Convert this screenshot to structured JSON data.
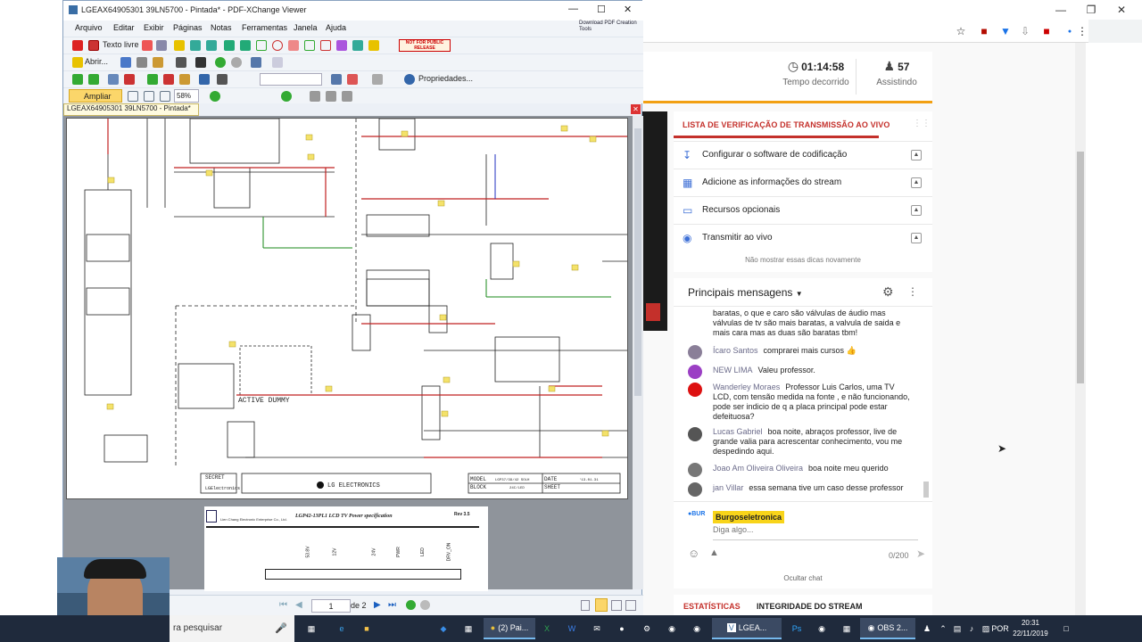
{
  "pdf": {
    "window_title": "LGEAX64905301 39LN5700 - Pintada* - PDF-XChange Viewer",
    "download_pdf_label": "Download PDF Creation Tools",
    "menu": [
      "Arquivo",
      "Editar",
      "Exibir",
      "Páginas",
      "Notas",
      "Ferramentas",
      "Janela",
      "Ajuda"
    ],
    "toolbar": {
      "text_tool": "Texto livre",
      "open": "Abrir...",
      "properties": "Propriedades...",
      "zoom_tool": "Ampliar",
      "zoom_value": "58%",
      "stamp": "NOT FOR PUBLIC RELEASE"
    },
    "doc_tab": "LGEAX64905301 39LN5700 - Pintada*",
    "schematic": {
      "active_dummy": "ACTIVE DUMMY",
      "brand": "LG ELECTRONICS",
      "secret": "SECRET",
      "lg_small": "LGElectronics",
      "model_label": "MODEL",
      "block_label": "BLOCK",
      "date_label": "DATE",
      "sheet_label": "SHEET",
      "model_value": "LGP37/39/42 SOLH",
      "block_value": "24C/LED",
      "date_value": "'13.01.31"
    },
    "page2": {
      "company": "Lien Chang Electronic Enterprise Co., Ltd.",
      "spec_title": "LGP42-13PL1 LCD TV Power specification",
      "rev": "Rev 3.5",
      "pins": [
        "53.8V",
        "12V",
        "24V",
        "PWR",
        "LED",
        "DRV_ON"
      ]
    },
    "status": {
      "page_current": "1",
      "page_total": "de 2"
    }
  },
  "browser": {
    "stats": [
      {
        "icon": "clock-icon",
        "value": "01:14:58",
        "label": "Tempo decorrido"
      },
      {
        "icon": "people-icon",
        "value": "57",
        "label": "Assistindo"
      }
    ],
    "checklist": {
      "title": "LISTA DE VERIFICAÇÃO DE TRANSMISSÃO AO VIVO",
      "items": [
        {
          "icon": "download-icon",
          "label": "Configurar o software de codificação"
        },
        {
          "icon": "chart-icon",
          "label": "Adicione as informações do stream"
        },
        {
          "icon": "card-icon",
          "label": "Recursos opcionais"
        },
        {
          "icon": "broadcast-icon",
          "label": "Transmitir ao vivo"
        }
      ],
      "hide_tips": "Não mostrar essas dicas novamente"
    },
    "chat": {
      "title": "Principais mensagens",
      "messages": [
        {
          "author": "",
          "text": "baratas, o que e caro são válvulas de áudio mas válvulas de tv são mais baratas, a valvula de saida e mais cara mas as duas são baratas tbm!",
          "color": "#ffffff"
        },
        {
          "author": "Ícaro Santos",
          "text": "comprarei mais cursos 👍",
          "color": "#8a7f98"
        },
        {
          "author": "NEW LIMA",
          "text": "Valeu professor.",
          "color": "#9b3fc4"
        },
        {
          "author": "Wanderley Moraes",
          "text": "Professor Luis Carlos, uma TV LCD, com tensão medida na fonte , e não funcionando, pode ser indicio de q a placa principal pode estar defeituosa?",
          "color": "#d11"
        },
        {
          "author": "Lucas Gabriel",
          "text": "boa noite, abraços professor, live de grande valia para acrescentar conhecimento, vou me despedindo aqui.",
          "color": "#555"
        },
        {
          "author": "Joao Am Oliveira Oliveira",
          "text": "boa noite meu querido",
          "color": "#777"
        },
        {
          "author": "jan Villar",
          "text": "essa semana tive um caso desse professor",
          "color": "#666"
        }
      ],
      "current_user": "Burgoseletronica",
      "input_placeholder": "Diga algo...",
      "char_count": "0/200",
      "hide_chat": "Ocultar chat"
    },
    "bottom_tabs": [
      "ESTATÍSTICAS",
      "INTEGRIDADE DO STREAM"
    ]
  },
  "taskbar": {
    "search_placeholder": "ra pesquisar",
    "apps": [
      {
        "name": "task-view",
        "label": ""
      },
      {
        "name": "edge",
        "label": ""
      },
      {
        "name": "explorer",
        "label": ""
      },
      {
        "name": "dropbox",
        "label": ""
      },
      {
        "name": "calculator",
        "label": ""
      },
      {
        "name": "chrome",
        "label": "(2) Pai..."
      },
      {
        "name": "excel",
        "label": ""
      },
      {
        "name": "word",
        "label": ""
      },
      {
        "name": "mail",
        "label": ""
      },
      {
        "name": "game",
        "label": ""
      },
      {
        "name": "pdf-xchange",
        "label": "LGEA..."
      },
      {
        "name": "photoshop",
        "label": ""
      },
      {
        "name": "obs",
        "label": "OBS 2..."
      }
    ],
    "language": "POR",
    "time": "20:31",
    "date": "22/11/2019"
  }
}
